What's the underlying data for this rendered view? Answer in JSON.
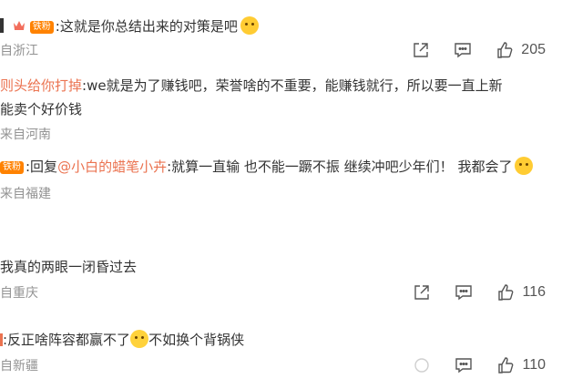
{
  "comments": [
    {
      "user": "",
      "badge": "铁粉",
      "text": ":这就是你总结出来的对策是吧",
      "location": "自浙江",
      "likes": "205"
    },
    {
      "user": "则头给你打掉",
      "text": ":we就是为了赚钱吧，荣誉啥的不重要，能赚钱就行，所以要一直上新",
      "text2": "能卖个好价钱",
      "location": "来自河南"
    },
    {
      "badge": "铁粉",
      "reply_prefix": ":回复",
      "mention": "@小白的蜡笔小卉",
      "text": ":就算一直输 也不能一蹶不振 继续冲吧少年们！  我都会了",
      "location": "来自福建"
    },
    {
      "text": "我真的两眼一闭昏过去",
      "location": "自重庆",
      "likes": "116"
    },
    {
      "text_a": ":反正啥阵容都赢不了",
      "text_b": "不如换个背锅侠",
      "location": "自新疆",
      "likes": "110"
    }
  ],
  "icons": [
    "share-icon",
    "comment-icon",
    "like-icon"
  ]
}
